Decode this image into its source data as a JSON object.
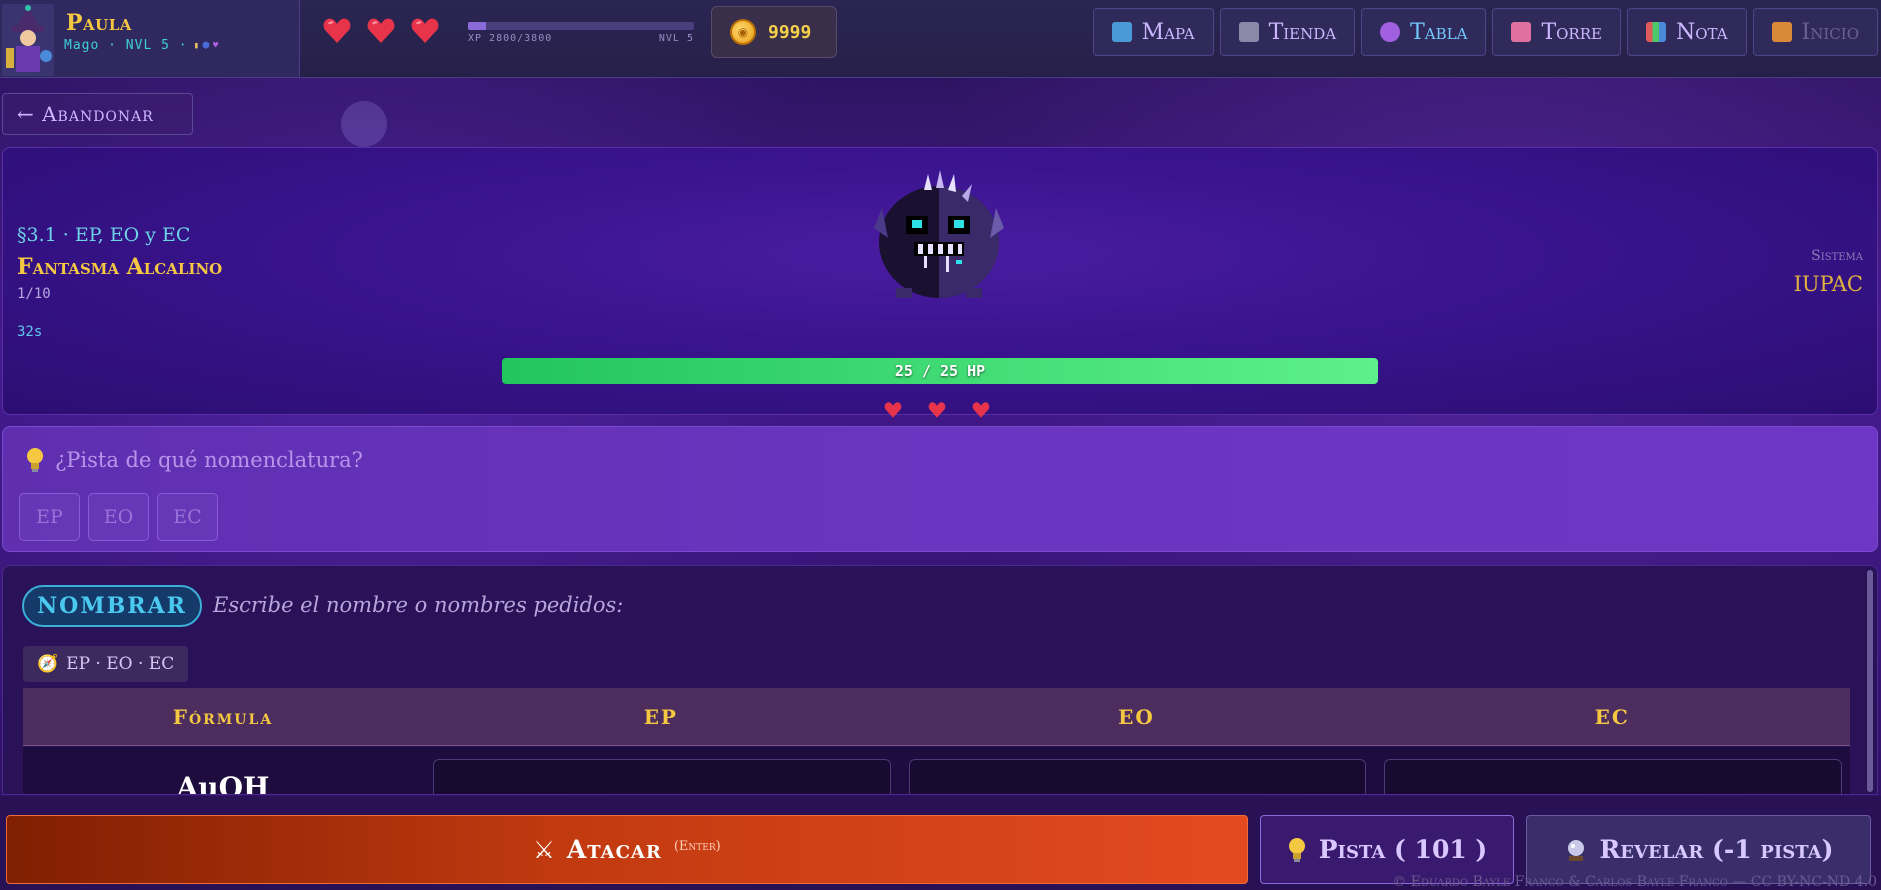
{
  "player": {
    "name": "Paula",
    "subtitle": "Mago · NVL 5 ·",
    "xp_text": "XP 2800/3800",
    "level_text": "NVL 5",
    "xp_fraction": 0.08,
    "hearts": 3,
    "coins": "9999"
  },
  "nav": [
    {
      "label": "Mapa",
      "icon": "map-icon",
      "state": "normal"
    },
    {
      "label": "Tienda",
      "icon": "shop-icon",
      "state": "normal"
    },
    {
      "label": "Tabla",
      "icon": "atom-icon",
      "state": "active"
    },
    {
      "label": "Torre",
      "icon": "castle-icon",
      "state": "normal"
    },
    {
      "label": "Nota",
      "icon": "chart-icon",
      "state": "normal"
    },
    {
      "label": "Inicio",
      "icon": "home-icon",
      "state": "disabled"
    }
  ],
  "abandon_label": "← Abandonar",
  "battle": {
    "section": "§3.1 · EP, EO y EC",
    "monster_name": "Fantasma Alcalino",
    "count": "1/10",
    "timer": "32s",
    "system_label": "Sistema",
    "system_value": "IUPAC",
    "hp_text": "25 / 25 HP",
    "hp_fraction": 1.0,
    "monster_hearts": 3
  },
  "hint_panel": {
    "question": "¿Pista de qué nomenclatura?",
    "options": [
      "EP",
      "EO",
      "EC"
    ]
  },
  "question": {
    "badge": "NOMBRAR",
    "instruction": "Escribe el nombre o nombres pedidos:",
    "chip": "EP · EO · EC",
    "columns": [
      "Fórmula",
      "EP",
      "EO",
      "EC"
    ],
    "formula": "AuOH"
  },
  "actions": {
    "attack_label": "Atacar",
    "attack_hint": "(Enter)",
    "hint_label": "Pista ( 101 )",
    "reveal_label": "Revelar (-1 pista)"
  },
  "footer": "© Eduardo Bayle Franco & Carlos Bayle Franco — CC BY-NC-ND 4.0",
  "colors": {
    "gold": "#f5c842",
    "cyan": "#4ac8ee",
    "hp_green": "#22c55e",
    "attack_red": "#c23a10"
  }
}
